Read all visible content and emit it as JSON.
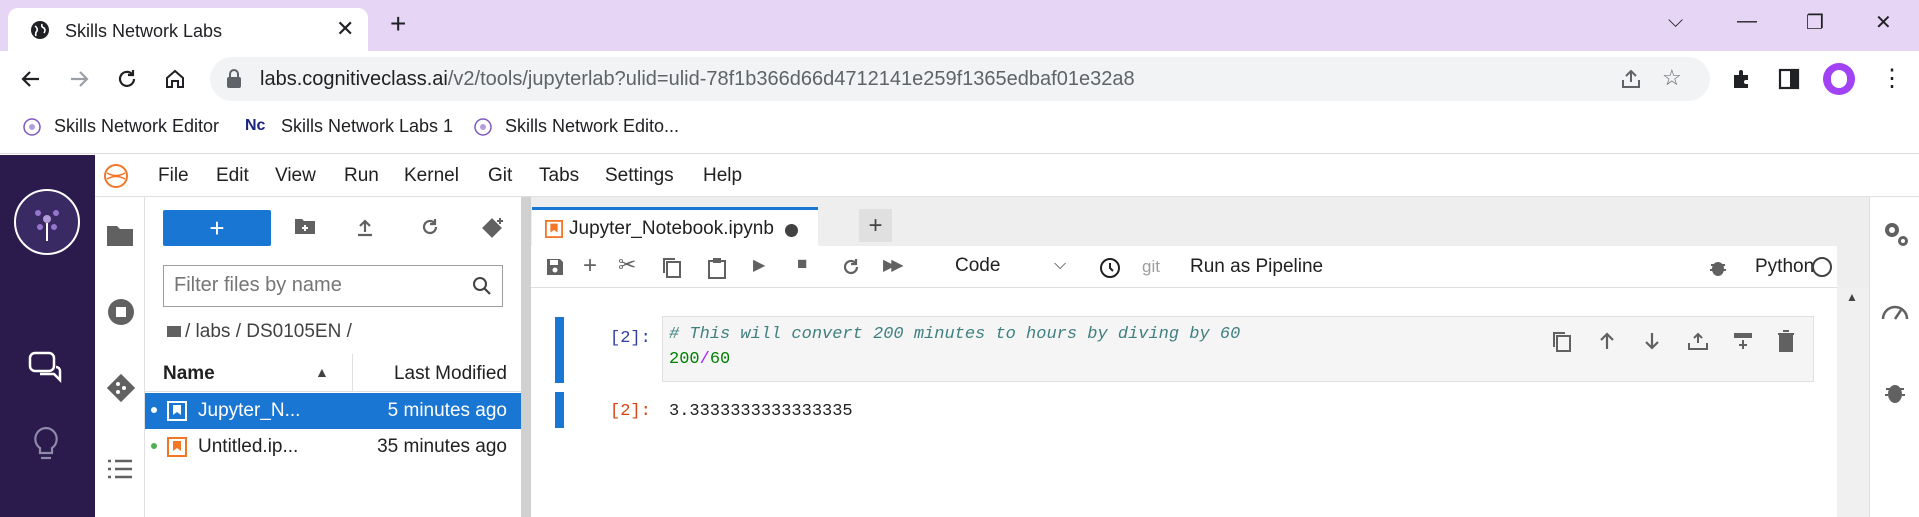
{
  "browser": {
    "tab_title": "Skills Network Labs",
    "url_host": "labs.cognitiveclass.ai",
    "url_path": "/v2/tools/jupyterlab?ulid=ulid-78f1b366d66d4712141e259f1365edbaf01e32a8",
    "bookmarks": [
      "Skills Network Editor",
      "Skills Network Labs 1",
      "Skills Network Edito..."
    ]
  },
  "jupyter": {
    "menu": [
      "File",
      "Edit",
      "View",
      "Run",
      "Kernel",
      "Git",
      "Tabs",
      "Settings",
      "Help"
    ],
    "filter_placeholder": "Filter files by name",
    "breadcrumb": "/ labs / DS0105EN /",
    "columns": {
      "name": "Name",
      "modified": "Last Modified"
    },
    "files": [
      {
        "name": "Jupyter_N...",
        "modified": "5 minutes ago",
        "selected": true
      },
      {
        "name": "Untitled.ip...",
        "modified": "35 minutes ago",
        "selected": false
      }
    ],
    "notebook_tab": "Jupyter_Notebook.ipynb",
    "cell_type": "Code",
    "git_label": "git",
    "run_pipeline": "Run as Pipeline",
    "kernel": "Python",
    "cells": {
      "in_prompt": "[2]:",
      "comment": "# This will convert 200 minutes to hours by diving by 60",
      "code_num1": "200",
      "code_op": "/",
      "code_num2": "60",
      "out_prompt": "[2]:",
      "output": "3.3333333333333335"
    }
  },
  "colors": {
    "accent": "#1976d2",
    "leftbar": "#2b1b4d",
    "tabstrip": "#e6d5f5"
  }
}
